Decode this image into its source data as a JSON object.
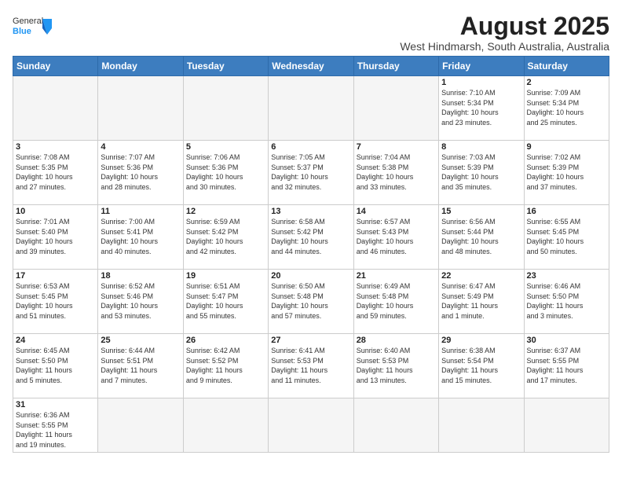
{
  "logo": {
    "text_general": "General",
    "text_blue": "Blue"
  },
  "title": "August 2025",
  "subtitle": "West Hindmarsh, South Australia, Australia",
  "weekdays": [
    "Sunday",
    "Monday",
    "Tuesday",
    "Wednesday",
    "Thursday",
    "Friday",
    "Saturday"
  ],
  "days": [
    {
      "num": "",
      "info": "",
      "empty": true
    },
    {
      "num": "",
      "info": "",
      "empty": true
    },
    {
      "num": "",
      "info": "",
      "empty": true
    },
    {
      "num": "",
      "info": "",
      "empty": true
    },
    {
      "num": "",
      "info": "",
      "empty": true
    },
    {
      "num": "1",
      "info": "Sunrise: 7:10 AM\nSunset: 5:34 PM\nDaylight: 10 hours\nand 23 minutes.",
      "empty": false
    },
    {
      "num": "2",
      "info": "Sunrise: 7:09 AM\nSunset: 5:34 PM\nDaylight: 10 hours\nand 25 minutes.",
      "empty": false
    },
    {
      "num": "3",
      "info": "Sunrise: 7:08 AM\nSunset: 5:35 PM\nDaylight: 10 hours\nand 27 minutes.",
      "empty": false
    },
    {
      "num": "4",
      "info": "Sunrise: 7:07 AM\nSunset: 5:36 PM\nDaylight: 10 hours\nand 28 minutes.",
      "empty": false
    },
    {
      "num": "5",
      "info": "Sunrise: 7:06 AM\nSunset: 5:36 PM\nDaylight: 10 hours\nand 30 minutes.",
      "empty": false
    },
    {
      "num": "6",
      "info": "Sunrise: 7:05 AM\nSunset: 5:37 PM\nDaylight: 10 hours\nand 32 minutes.",
      "empty": false
    },
    {
      "num": "7",
      "info": "Sunrise: 7:04 AM\nSunset: 5:38 PM\nDaylight: 10 hours\nand 33 minutes.",
      "empty": false
    },
    {
      "num": "8",
      "info": "Sunrise: 7:03 AM\nSunset: 5:39 PM\nDaylight: 10 hours\nand 35 minutes.",
      "empty": false
    },
    {
      "num": "9",
      "info": "Sunrise: 7:02 AM\nSunset: 5:39 PM\nDaylight: 10 hours\nand 37 minutes.",
      "empty": false
    },
    {
      "num": "10",
      "info": "Sunrise: 7:01 AM\nSunset: 5:40 PM\nDaylight: 10 hours\nand 39 minutes.",
      "empty": false
    },
    {
      "num": "11",
      "info": "Sunrise: 7:00 AM\nSunset: 5:41 PM\nDaylight: 10 hours\nand 40 minutes.",
      "empty": false
    },
    {
      "num": "12",
      "info": "Sunrise: 6:59 AM\nSunset: 5:42 PM\nDaylight: 10 hours\nand 42 minutes.",
      "empty": false
    },
    {
      "num": "13",
      "info": "Sunrise: 6:58 AM\nSunset: 5:42 PM\nDaylight: 10 hours\nand 44 minutes.",
      "empty": false
    },
    {
      "num": "14",
      "info": "Sunrise: 6:57 AM\nSunset: 5:43 PM\nDaylight: 10 hours\nand 46 minutes.",
      "empty": false
    },
    {
      "num": "15",
      "info": "Sunrise: 6:56 AM\nSunset: 5:44 PM\nDaylight: 10 hours\nand 48 minutes.",
      "empty": false
    },
    {
      "num": "16",
      "info": "Sunrise: 6:55 AM\nSunset: 5:45 PM\nDaylight: 10 hours\nand 50 minutes.",
      "empty": false
    },
    {
      "num": "17",
      "info": "Sunrise: 6:53 AM\nSunset: 5:45 PM\nDaylight: 10 hours\nand 51 minutes.",
      "empty": false
    },
    {
      "num": "18",
      "info": "Sunrise: 6:52 AM\nSunset: 5:46 PM\nDaylight: 10 hours\nand 53 minutes.",
      "empty": false
    },
    {
      "num": "19",
      "info": "Sunrise: 6:51 AM\nSunset: 5:47 PM\nDaylight: 10 hours\nand 55 minutes.",
      "empty": false
    },
    {
      "num": "20",
      "info": "Sunrise: 6:50 AM\nSunset: 5:48 PM\nDaylight: 10 hours\nand 57 minutes.",
      "empty": false
    },
    {
      "num": "21",
      "info": "Sunrise: 6:49 AM\nSunset: 5:48 PM\nDaylight: 10 hours\nand 59 minutes.",
      "empty": false
    },
    {
      "num": "22",
      "info": "Sunrise: 6:47 AM\nSunset: 5:49 PM\nDaylight: 11 hours\nand 1 minute.",
      "empty": false
    },
    {
      "num": "23",
      "info": "Sunrise: 6:46 AM\nSunset: 5:50 PM\nDaylight: 11 hours\nand 3 minutes.",
      "empty": false
    },
    {
      "num": "24",
      "info": "Sunrise: 6:45 AM\nSunset: 5:50 PM\nDaylight: 11 hours\nand 5 minutes.",
      "empty": false
    },
    {
      "num": "25",
      "info": "Sunrise: 6:44 AM\nSunset: 5:51 PM\nDaylight: 11 hours\nand 7 minutes.",
      "empty": false
    },
    {
      "num": "26",
      "info": "Sunrise: 6:42 AM\nSunset: 5:52 PM\nDaylight: 11 hours\nand 9 minutes.",
      "empty": false
    },
    {
      "num": "27",
      "info": "Sunrise: 6:41 AM\nSunset: 5:53 PM\nDaylight: 11 hours\nand 11 minutes.",
      "empty": false
    },
    {
      "num": "28",
      "info": "Sunrise: 6:40 AM\nSunset: 5:53 PM\nDaylight: 11 hours\nand 13 minutes.",
      "empty": false
    },
    {
      "num": "29",
      "info": "Sunrise: 6:38 AM\nSunset: 5:54 PM\nDaylight: 11 hours\nand 15 minutes.",
      "empty": false
    },
    {
      "num": "30",
      "info": "Sunrise: 6:37 AM\nSunset: 5:55 PM\nDaylight: 11 hours\nand 17 minutes.",
      "empty": false
    },
    {
      "num": "31",
      "info": "Sunrise: 6:36 AM\nSunset: 5:55 PM\nDaylight: 11 hours\nand 19 minutes.",
      "empty": false
    }
  ]
}
